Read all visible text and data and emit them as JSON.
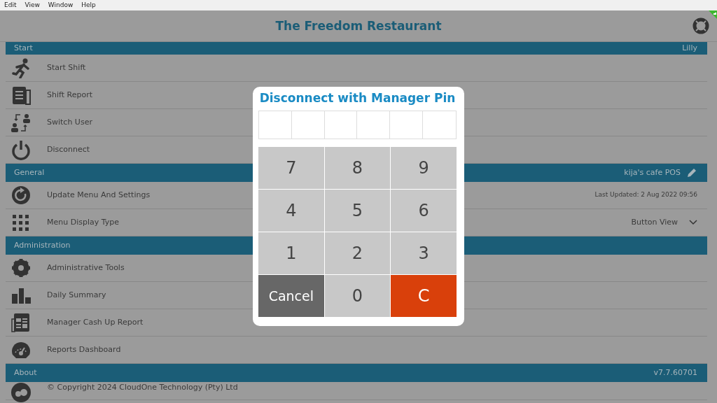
{
  "menu_bar": [
    "Edit",
    "View",
    "Window",
    "Help"
  ],
  "app_title": "The Freedom Restaurant",
  "sections": [
    {
      "title": "Start",
      "right_text": "Lilly",
      "editable": false,
      "items": [
        {
          "label": "Start Shift"
        },
        {
          "label": "Shift Report"
        },
        {
          "label": "Switch User"
        },
        {
          "label": "Disconnect"
        }
      ]
    },
    {
      "title": "General",
      "right_text": "kija's cafe POS",
      "editable": true,
      "items": [
        {
          "label": "Update Menu And Settings",
          "note": "Last Updated: 2 Aug 2022 09:56"
        },
        {
          "label": "Menu Display Type",
          "dropdown": "Button View"
        }
      ]
    },
    {
      "title": "Administration",
      "editable": false,
      "items": [
        {
          "label": "Administrative Tools"
        },
        {
          "label": "Daily Summary"
        },
        {
          "label": "Manager Cash Up Report"
        },
        {
          "label": "Reports Dashboard"
        }
      ]
    },
    {
      "title": "About",
      "right_text": "v7.7.60701",
      "editable": false,
      "items": [
        {
          "label": "© Copyright 2024 CloudOne Technology (Pty) Ltd"
        }
      ]
    }
  ],
  "dialog": {
    "title": "Disconnect with Manager Pin",
    "pin_digits": [
      {
        "filled": false
      },
      {
        "filled": false
      },
      {
        "filled": false
      },
      {
        "filled": false
      },
      {
        "filled": false
      },
      {
        "filled": false
      }
    ],
    "keys": [
      {
        "label": "7",
        "kind": "digit"
      },
      {
        "label": "8",
        "kind": "digit"
      },
      {
        "label": "9",
        "kind": "digit"
      },
      {
        "label": "4",
        "kind": "digit"
      },
      {
        "label": "5",
        "kind": "digit"
      },
      {
        "label": "6",
        "kind": "digit"
      },
      {
        "label": "1",
        "kind": "digit"
      },
      {
        "label": "2",
        "kind": "digit"
      },
      {
        "label": "3",
        "kind": "digit"
      },
      {
        "label": "Cancel",
        "kind": "cancel"
      },
      {
        "label": "0",
        "kind": "digit"
      },
      {
        "label": "C",
        "kind": "clear"
      }
    ]
  }
}
